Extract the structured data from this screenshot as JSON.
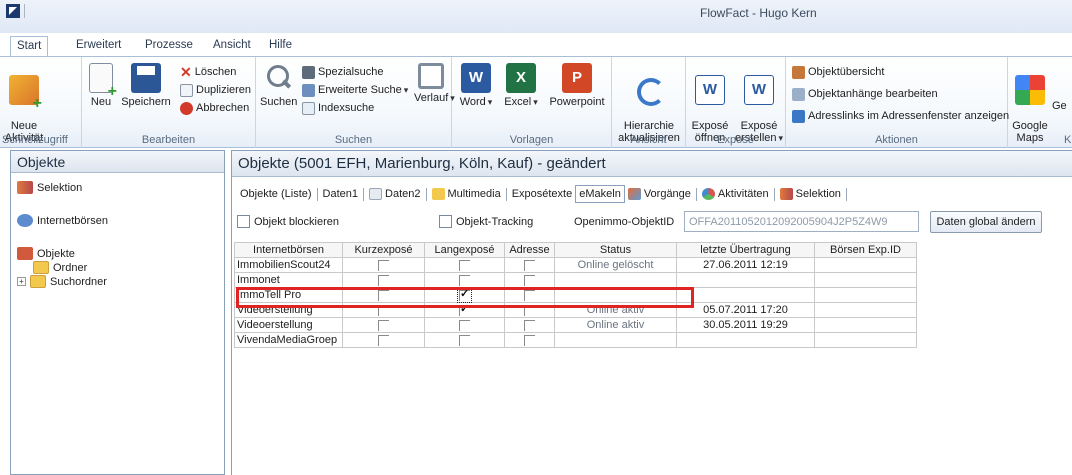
{
  "app": {
    "window_title": "FlowFact - Hugo Kern"
  },
  "ribbon_tabs": [
    "Start",
    "Erweitert",
    "Prozesse",
    "Ansicht",
    "Hilfe"
  ],
  "ribbon": {
    "schnellzugriff": {
      "label": "Schnellzugriff",
      "neue_aktivitaet": "Neue\nAktivität"
    },
    "bearbeiten": {
      "label": "Bearbeiten",
      "neu": "Neu",
      "speichern": "Speichern",
      "loeschen": "Löschen",
      "duplizieren": "Duplizieren",
      "abbrechen": "Abbrechen"
    },
    "suchen": {
      "label": "Suchen",
      "suchen": "Suchen",
      "spezialsuche": "Spezialsuche",
      "erweiterte_suche": "Erweiterte Suche",
      "indexsuche": "Indexsuche",
      "verlauf": "Verlauf"
    },
    "vorlagen": {
      "label": "Vorlagen",
      "word": "Word",
      "excel": "Excel",
      "powerpoint": "Powerpoint"
    },
    "ansicht": {
      "label": "Ansicht",
      "hierarchie": "Hierarchie\naktualisieren"
    },
    "expose": {
      "label": "Exposé",
      "oeffnen": "Exposé\nöffnen",
      "erstellen": "Exposé\nerstellen"
    },
    "aktionen": {
      "label": "Aktionen",
      "objektuebersicht": "Objektübersicht",
      "objektanhaenge": "Objektanhänge bearbeiten",
      "adresslinks": "Adresslinks im Adressenfenster anzeigen"
    },
    "extra": {
      "google_maps": "Google\nMaps",
      "cut_label": "Ge",
      "cut_group": "K"
    }
  },
  "left_panel": {
    "title": "Objekte",
    "items": [
      "Selektion",
      "Internetbörsen",
      "Objekte",
      "Ordner",
      "Suchordner"
    ]
  },
  "main": {
    "title": "Objekte (5001 EFH, Marienburg, Köln, Kauf) - geändert",
    "subtabs": [
      "Objekte (Liste)",
      "Daten1",
      "Daten2",
      "Multimedia",
      "Exposétexte",
      "eMakeln",
      "Vorgänge",
      "Aktivitäten",
      "Selektion"
    ],
    "options": {
      "objekt_blockieren": "Objekt blockieren",
      "objekt_tracking": "Objekt-Tracking",
      "openimmo_label": "Openimmo-ObjektID",
      "openimmo_value": "OFFA2011052012092005904J2P5Z4W9",
      "daten_global": "Daten global ändern"
    },
    "table": {
      "columns": [
        "Internetbörsen",
        "Kurzexposé",
        "Langexposé",
        "Adresse",
        "Status",
        "letzte Übertragung",
        "Börsen Exp.ID"
      ],
      "rows": [
        {
          "name": "ImmobilienScout24",
          "kurz": false,
          "lang": false,
          "adresse": false,
          "status": "Online gelöscht",
          "uebertragung": "27.06.2011 12:19",
          "exp_id": ""
        },
        {
          "name": "Immonet",
          "kurz": false,
          "lang": false,
          "adresse": false,
          "status": "",
          "uebertragung": "",
          "exp_id": ""
        },
        {
          "name": "ImmoTell Pro",
          "kurz": false,
          "lang": true,
          "adresse": false,
          "status": "",
          "uebertragung": "",
          "exp_id": ""
        },
        {
          "name": "Videoerstellung",
          "kurz": false,
          "lang": true,
          "adresse": false,
          "status": "Online aktiv",
          "uebertragung": "05.07.2011 17:20",
          "exp_id": ""
        },
        {
          "name": "Videoerstellung",
          "kurz": false,
          "lang": false,
          "adresse": false,
          "status": "Online aktiv",
          "uebertragung": "30.05.2011 19:29",
          "exp_id": ""
        },
        {
          "name": "VivendaMediaGroep",
          "kurz": false,
          "lang": false,
          "adresse": false,
          "status": "",
          "uebertragung": "",
          "exp_id": ""
        }
      ]
    }
  },
  "colors": {
    "highlight": "#e02424",
    "panel_border": "#8aa1bc",
    "ribbon_border": "#a9bfd6"
  }
}
